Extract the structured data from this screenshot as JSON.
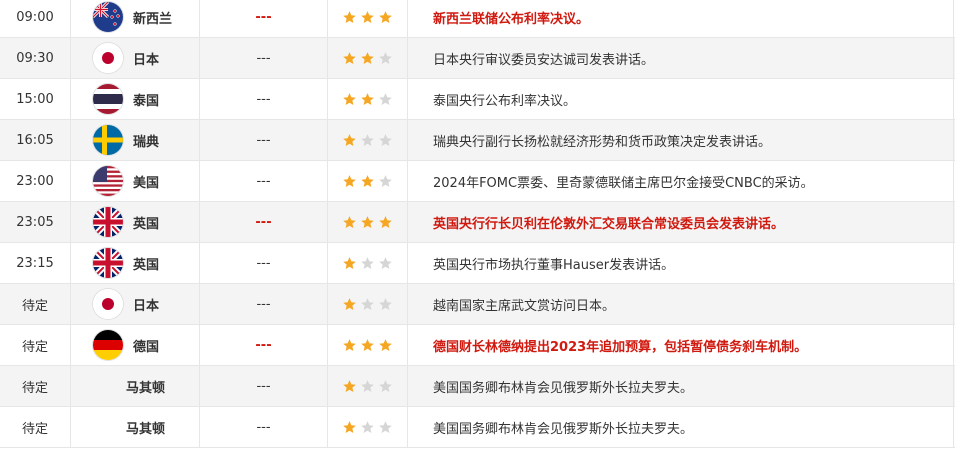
{
  "colors": {
    "important": "#d0190f",
    "star_on": "#f5a623",
    "star_off": "#d6d6d6"
  },
  "rows": [
    {
      "time": "09:00",
      "flag": "nz-flag-icon",
      "country": "新西兰",
      "value": "---",
      "stars": 3,
      "event": "新西兰联储公布利率决议。",
      "important": true
    },
    {
      "time": "09:30",
      "flag": "jp-flag-icon",
      "country": "日本",
      "value": "---",
      "stars": 2,
      "event": "日本央行审议委员安达诚司发表讲话。",
      "important": false
    },
    {
      "time": "15:00",
      "flag": "th-flag-icon",
      "country": "泰国",
      "value": "---",
      "stars": 2,
      "event": "泰国央行公布利率决议。",
      "important": false
    },
    {
      "time": "16:05",
      "flag": "se-flag-icon",
      "country": "瑞典",
      "value": "---",
      "stars": 1,
      "event": "瑞典央行副行长扬松就经济形势和货币政策决定发表讲话。",
      "important": false
    },
    {
      "time": "23:00",
      "flag": "us-flag-icon",
      "country": "美国",
      "value": "---",
      "stars": 2,
      "event": "2024年FOMC票委、里奇蒙德联储主席巴尔金接受CNBC的采访。",
      "important": false
    },
    {
      "time": "23:05",
      "flag": "uk-flag-icon",
      "country": "英国",
      "value": "---",
      "stars": 3,
      "event": "英国央行行长贝利在伦敦外汇交易联合常设委员会发表讲话。",
      "important": true
    },
    {
      "time": "23:15",
      "flag": "uk-flag-icon",
      "country": "英国",
      "value": "---",
      "stars": 1,
      "event": "英国央行市场执行董事Hauser发表讲话。",
      "important": false
    },
    {
      "time": "待定",
      "flag": "jp-flag-icon",
      "country": "日本",
      "value": "---",
      "stars": 1,
      "event": "越南国家主席武文赏访问日本。",
      "important": false
    },
    {
      "time": "待定",
      "flag": "de-flag-icon",
      "country": "德国",
      "value": "---",
      "stars": 3,
      "event": "德国财长林德纳提出2023年追加预算，包括暂停债务刹车机制。",
      "important": true
    },
    {
      "time": "待定",
      "flag": "",
      "country": "马其顿",
      "value": "---",
      "stars": 1,
      "event": "美国国务卿布林肯会见俄罗斯外长拉夫罗夫。",
      "important": false
    },
    {
      "time": "待定",
      "flag": "",
      "country": "马其顿",
      "value": "---",
      "stars": 1,
      "event": "美国国务卿布林肯会见俄罗斯外长拉夫罗夫。",
      "important": false
    }
  ]
}
